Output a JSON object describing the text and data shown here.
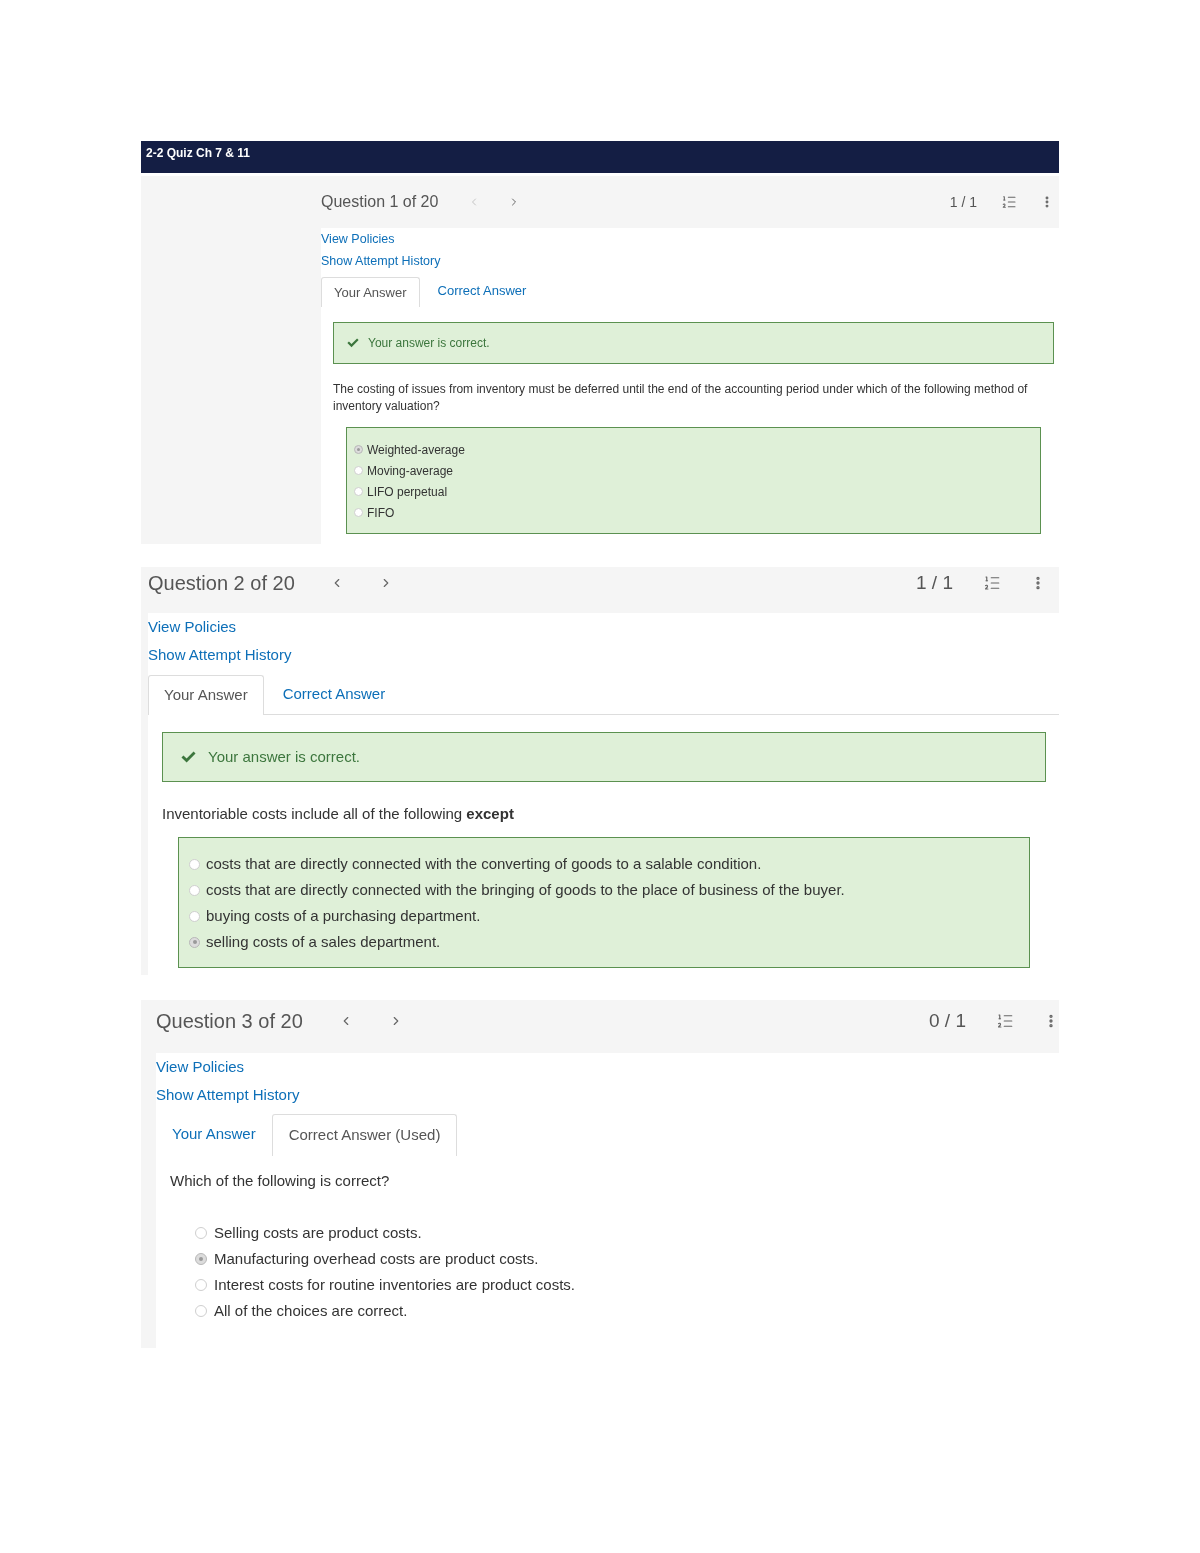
{
  "quiz_title": "2-2 Quiz Ch 7 & 11",
  "questions": [
    {
      "title": "Question 1 of 20",
      "prev_disabled": true,
      "score": "1 / 1",
      "links": [
        "View Policies",
        "Show Attempt History"
      ],
      "tabs": [
        {
          "label": "Your Answer",
          "selected": true
        },
        {
          "label": "Correct Answer",
          "selected": false
        }
      ],
      "feedback": "Your answer is correct.",
      "prompt": "The costing of issues from inventory must be deferred until the end of the accounting period under which of the following method of inventory valuation?",
      "answered_correctly": true,
      "options": [
        {
          "label": "Weighted-average",
          "selected": true
        },
        {
          "label": "Moving-average",
          "selected": false
        },
        {
          "label": "LIFO perpetual",
          "selected": false
        },
        {
          "label": "FIFO",
          "selected": false
        }
      ]
    },
    {
      "title": "Question 2 of 20",
      "prev_disabled": false,
      "score": "1 / 1",
      "links": [
        "View Policies",
        "Show Attempt History"
      ],
      "tabs": [
        {
          "label": "Your Answer",
          "selected": true
        },
        {
          "label": "Correct Answer",
          "selected": false
        }
      ],
      "feedback": "Your answer is correct.",
      "prompt": "Inventoriable costs include all of the following **except**",
      "answered_correctly": true,
      "options": [
        {
          "label": "costs that are directly connected with the converting of goods to a salable condition.",
          "selected": false
        },
        {
          "label": "costs that are directly connected with the bringing of goods to the place of business of the buyer.",
          "selected": false
        },
        {
          "label": "buying costs of a purchasing department.",
          "selected": false
        },
        {
          "label": "selling costs of a sales department.",
          "selected": true
        }
      ]
    },
    {
      "title": "Question 3 of 20",
      "prev_disabled": false,
      "score": "0 / 1",
      "links": [
        "View Policies",
        "Show Attempt History"
      ],
      "tabs": [
        {
          "label": "Your Answer",
          "selected": false
        },
        {
          "label": "Correct Answer (Used)",
          "selected": true
        }
      ],
      "prompt": "Which of the following is correct?",
      "answered_correctly": false,
      "options": [
        {
          "label": "Selling costs are product costs.",
          "selected": false
        },
        {
          "label": "Manufacturing overhead costs are product costs.",
          "selected": true
        },
        {
          "label": "Interest costs for routine inventories are product costs.",
          "selected": false
        },
        {
          "label": "All of the choices are correct.",
          "selected": false
        }
      ]
    }
  ]
}
